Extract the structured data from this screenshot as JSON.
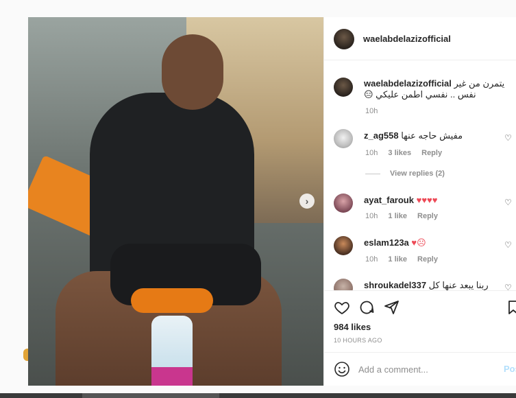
{
  "post": {
    "author": "waelabdelazizofficial",
    "caption_line1": "يتمرن من غير",
    "caption_line2": "نفس .. نفسي اطمن عليكي 😑",
    "caption_time": "10h"
  },
  "comments": [
    {
      "user": "z_ag558",
      "text": "مفيش حاجه عنها",
      "time": "10h",
      "likes": "3 likes",
      "reply_label": "Reply",
      "view_replies": "View replies (2)"
    },
    {
      "user": "ayat_farouk",
      "text": "♥♥♥♥",
      "time": "10h",
      "likes": "1 like",
      "reply_label": "Reply"
    },
    {
      "user": "eslam123a",
      "text": "♥☹",
      "time": "10h",
      "likes": "1 like",
      "reply_label": "Reply"
    },
    {
      "user": "shroukadel337",
      "text": "ربنا يبعد عنها كل"
    }
  ],
  "actions": {
    "likes_count": "984 likes",
    "timestamp": "10 HOURS AGO",
    "add_comment_placeholder": "Add a comment...",
    "post_label": "Post"
  },
  "icons": {
    "like": "heart-icon",
    "comment": "comment-bubble-icon",
    "share": "paper-plane-icon",
    "save": "bookmark-icon",
    "emoji": "emoji-smile-icon",
    "next": "chevron-right-icon"
  },
  "colors": {
    "heart_red": "#ed4956",
    "meta_gray": "#8e8e8e",
    "post_button_disabled": "#b2dffc"
  }
}
